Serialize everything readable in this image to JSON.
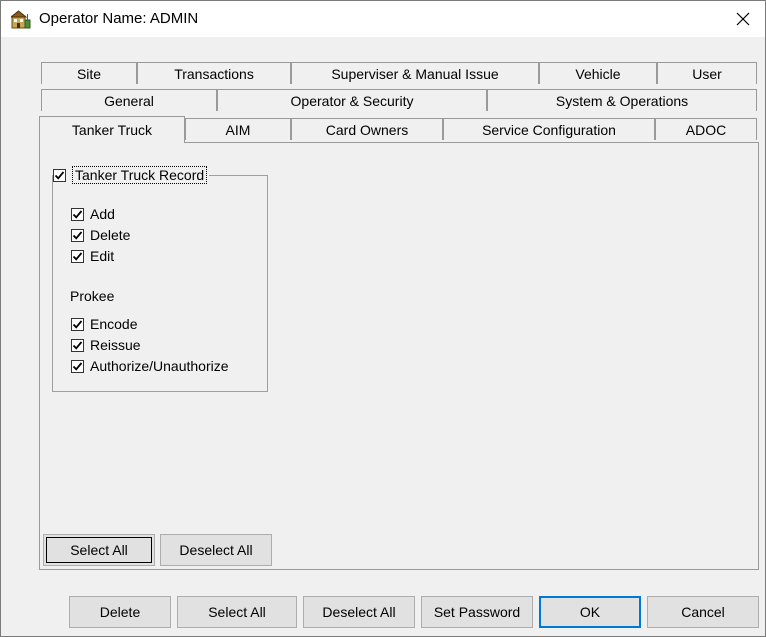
{
  "window": {
    "title": "Operator Name: ADMIN"
  },
  "tabs": {
    "row1": [
      "Site",
      "Transactions",
      "Superviser & Manual Issue",
      "Vehicle",
      "User"
    ],
    "row2": [
      "General",
      "Operator & Security",
      "System & Operations"
    ],
    "row3": [
      "Tanker Truck",
      "AIM",
      "Card Owners",
      "Service Configuration",
      "ADOC"
    ],
    "active": "Tanker Truck"
  },
  "panel": {
    "group_title": "Tanker Truck Record",
    "group_checked": true,
    "items": [
      {
        "label": "Add",
        "checked": true
      },
      {
        "label": "Delete",
        "checked": true
      },
      {
        "label": "Edit",
        "checked": true
      }
    ],
    "sub_label": "Prokee",
    "sub_items": [
      {
        "label": "Encode",
        "checked": true
      },
      {
        "label": "Reissue",
        "checked": true
      },
      {
        "label": "Authorize/Unauthorize",
        "checked": true
      }
    ],
    "select_all": "Select All",
    "deselect_all": "Deselect All"
  },
  "footer": {
    "delete": "Delete",
    "select_all": "Select All",
    "deselect_all": "Deselect All",
    "set_password": "Set Password",
    "ok": "OK",
    "cancel": "Cancel"
  }
}
